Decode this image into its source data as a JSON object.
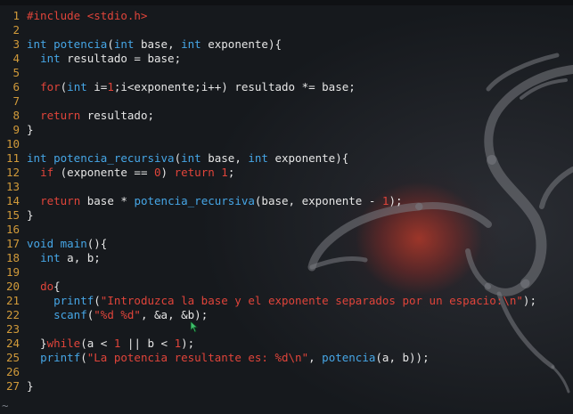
{
  "editor": {
    "lines": [
      {
        "n": "1",
        "t": [
          [
            "pp",
            "#include <stdio.h>"
          ]
        ]
      },
      {
        "n": "2",
        "t": []
      },
      {
        "n": "3",
        "t": [
          [
            "ty",
            "int"
          ],
          [
            "",
            " "
          ],
          [
            "fn",
            "potencia"
          ],
          [
            "",
            "("
          ],
          [
            "ty",
            "int"
          ],
          [
            "",
            " base, "
          ],
          [
            "ty",
            "int"
          ],
          [
            "",
            " exponente){"
          ]
        ]
      },
      {
        "n": "4",
        "t": [
          [
            "",
            "  "
          ],
          [
            "ty",
            "int"
          ],
          [
            "",
            " resultado = base;"
          ]
        ]
      },
      {
        "n": "5",
        "t": []
      },
      {
        "n": "6",
        "t": [
          [
            "",
            "  "
          ],
          [
            "kw",
            "for"
          ],
          [
            "",
            "("
          ],
          [
            "ty",
            "int"
          ],
          [
            "",
            " i="
          ],
          [
            "num",
            "1"
          ],
          [
            "",
            ";i<exponente;i++) resultado *= base;"
          ]
        ]
      },
      {
        "n": "7",
        "t": []
      },
      {
        "n": "8",
        "t": [
          [
            "",
            "  "
          ],
          [
            "kw",
            "return"
          ],
          [
            "",
            " resultado;"
          ]
        ]
      },
      {
        "n": "9",
        "t": [
          [
            "",
            "}"
          ]
        ]
      },
      {
        "n": "10",
        "t": []
      },
      {
        "n": "11",
        "t": [
          [
            "ty",
            "int"
          ],
          [
            "",
            " "
          ],
          [
            "fn",
            "potencia_recursiva"
          ],
          [
            "",
            "("
          ],
          [
            "ty",
            "int"
          ],
          [
            "",
            " base, "
          ],
          [
            "ty",
            "int"
          ],
          [
            "",
            " exponente){"
          ]
        ]
      },
      {
        "n": "12",
        "t": [
          [
            "",
            "  "
          ],
          [
            "kw",
            "if"
          ],
          [
            "",
            " (exponente == "
          ],
          [
            "num",
            "0"
          ],
          [
            "",
            ") "
          ],
          [
            "kw",
            "return"
          ],
          [
            "",
            " "
          ],
          [
            "num",
            "1"
          ],
          [
            "",
            ";"
          ]
        ]
      },
      {
        "n": "13",
        "t": []
      },
      {
        "n": "14",
        "t": [
          [
            "",
            "  "
          ],
          [
            "kw",
            "return"
          ],
          [
            "",
            " base * "
          ],
          [
            "fn",
            "potencia_recursiva"
          ],
          [
            "",
            "(base, exponente - "
          ],
          [
            "num",
            "1"
          ],
          [
            "",
            ");"
          ]
        ]
      },
      {
        "n": "15",
        "t": [
          [
            "",
            "}"
          ]
        ]
      },
      {
        "n": "16",
        "t": []
      },
      {
        "n": "17",
        "t": [
          [
            "ty",
            "void"
          ],
          [
            "",
            " "
          ],
          [
            "fn",
            "main"
          ],
          [
            "",
            "(){"
          ]
        ]
      },
      {
        "n": "18",
        "t": [
          [
            "",
            "  "
          ],
          [
            "ty",
            "int"
          ],
          [
            "",
            " a, b;"
          ]
        ]
      },
      {
        "n": "19",
        "t": []
      },
      {
        "n": "20",
        "t": [
          [
            "",
            "  "
          ],
          [
            "kw",
            "do"
          ],
          [
            "",
            "{"
          ]
        ]
      },
      {
        "n": "21",
        "t": [
          [
            "",
            "    "
          ],
          [
            "fn",
            "printf"
          ],
          [
            "",
            "("
          ],
          [
            "str",
            "\"Introduzca la base y el exponente separados por un espacio:\\n\""
          ],
          [
            "",
            ");"
          ]
        ]
      },
      {
        "n": "22",
        "t": [
          [
            "",
            "    "
          ],
          [
            "fn",
            "scanf"
          ],
          [
            "",
            "("
          ],
          [
            "str",
            "\"%d %d\""
          ],
          [
            "",
            ", &a, &b);"
          ]
        ]
      },
      {
        "n": "23",
        "t": []
      },
      {
        "n": "24",
        "t": [
          [
            "",
            "  }"
          ],
          [
            "kw",
            "while"
          ],
          [
            "",
            "(a < "
          ],
          [
            "num",
            "1"
          ],
          [
            "",
            " || b < "
          ],
          [
            "num",
            "1"
          ],
          [
            "",
            ");"
          ]
        ]
      },
      {
        "n": "25",
        "t": [
          [
            "",
            "  "
          ],
          [
            "fn",
            "printf"
          ],
          [
            "",
            "("
          ],
          [
            "str",
            "\"La potencia resultante es: %d\\n\""
          ],
          [
            "",
            ", "
          ],
          [
            "fn",
            "potencia"
          ],
          [
            "",
            "(a, b));"
          ]
        ]
      },
      {
        "n": "26",
        "t": []
      },
      {
        "n": "27",
        "t": [
          [
            "",
            "}"
          ]
        ]
      }
    ],
    "end_of_buffer_marker": "~"
  },
  "colors": {
    "background": "#16191d",
    "line_number": "#d19a3a",
    "keyword": "#e0443a",
    "type_and_function": "#46a6e6",
    "default_text": "#e6e6e6"
  },
  "icons": {
    "wallpaper": "kali-dragon-logo",
    "pointer": "mouse-cursor-icon"
  }
}
